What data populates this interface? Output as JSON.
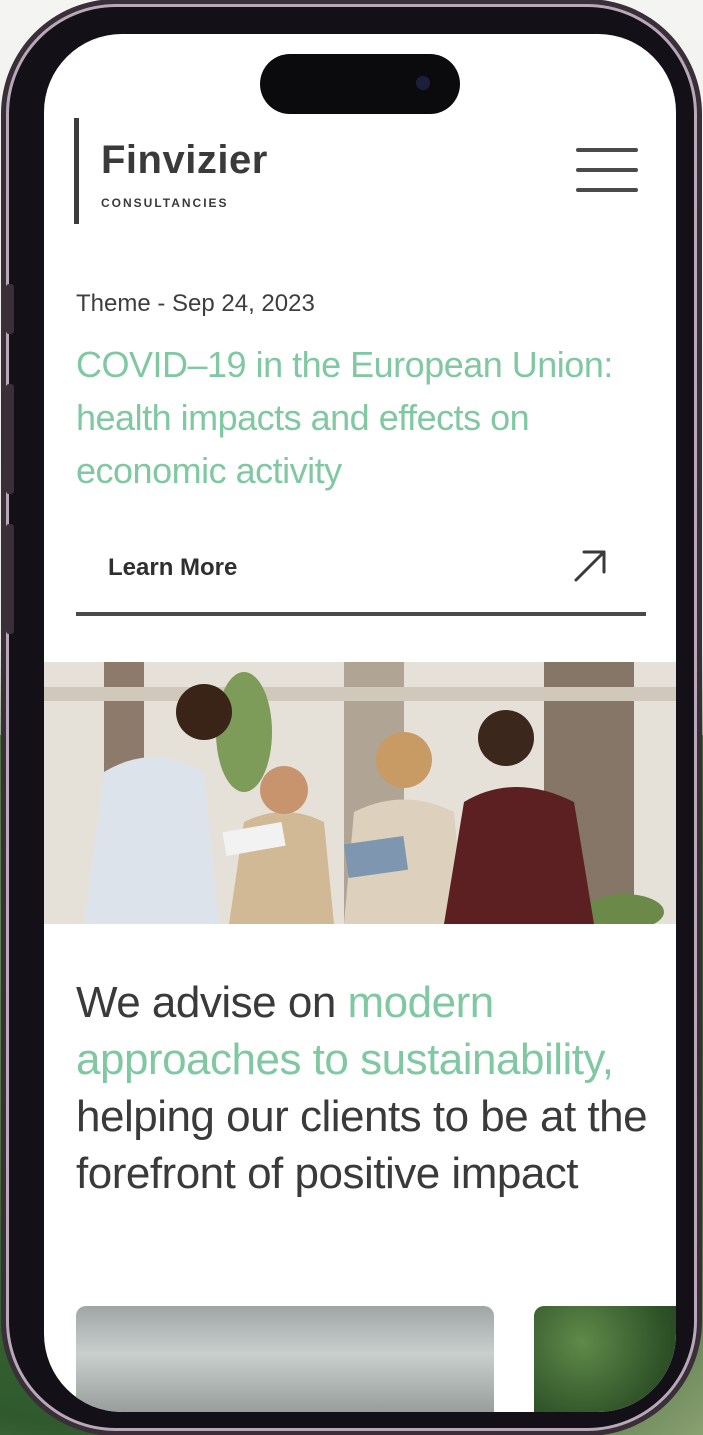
{
  "brand": {
    "name": "Finvizier",
    "subtitle": "CONSULTANCIES"
  },
  "article": {
    "meta": "Theme - Sep 24, 2023",
    "title": "COVID–19 in the European Union: health impacts and effects on economic activity",
    "cta_label": "Learn More",
    "cta_icon": "arrow-up-right-icon"
  },
  "statement": {
    "prefix": "We advise on ",
    "highlight": "modern approaches to sustainability,",
    "suffix": " helping our clients to be at the forefront of positive impact"
  },
  "colors": {
    "accent": "#7fc8a2",
    "text": "#3a3a3a",
    "divider": "#4a4a4a"
  },
  "icons": {
    "menu": "hamburger-menu-icon"
  }
}
